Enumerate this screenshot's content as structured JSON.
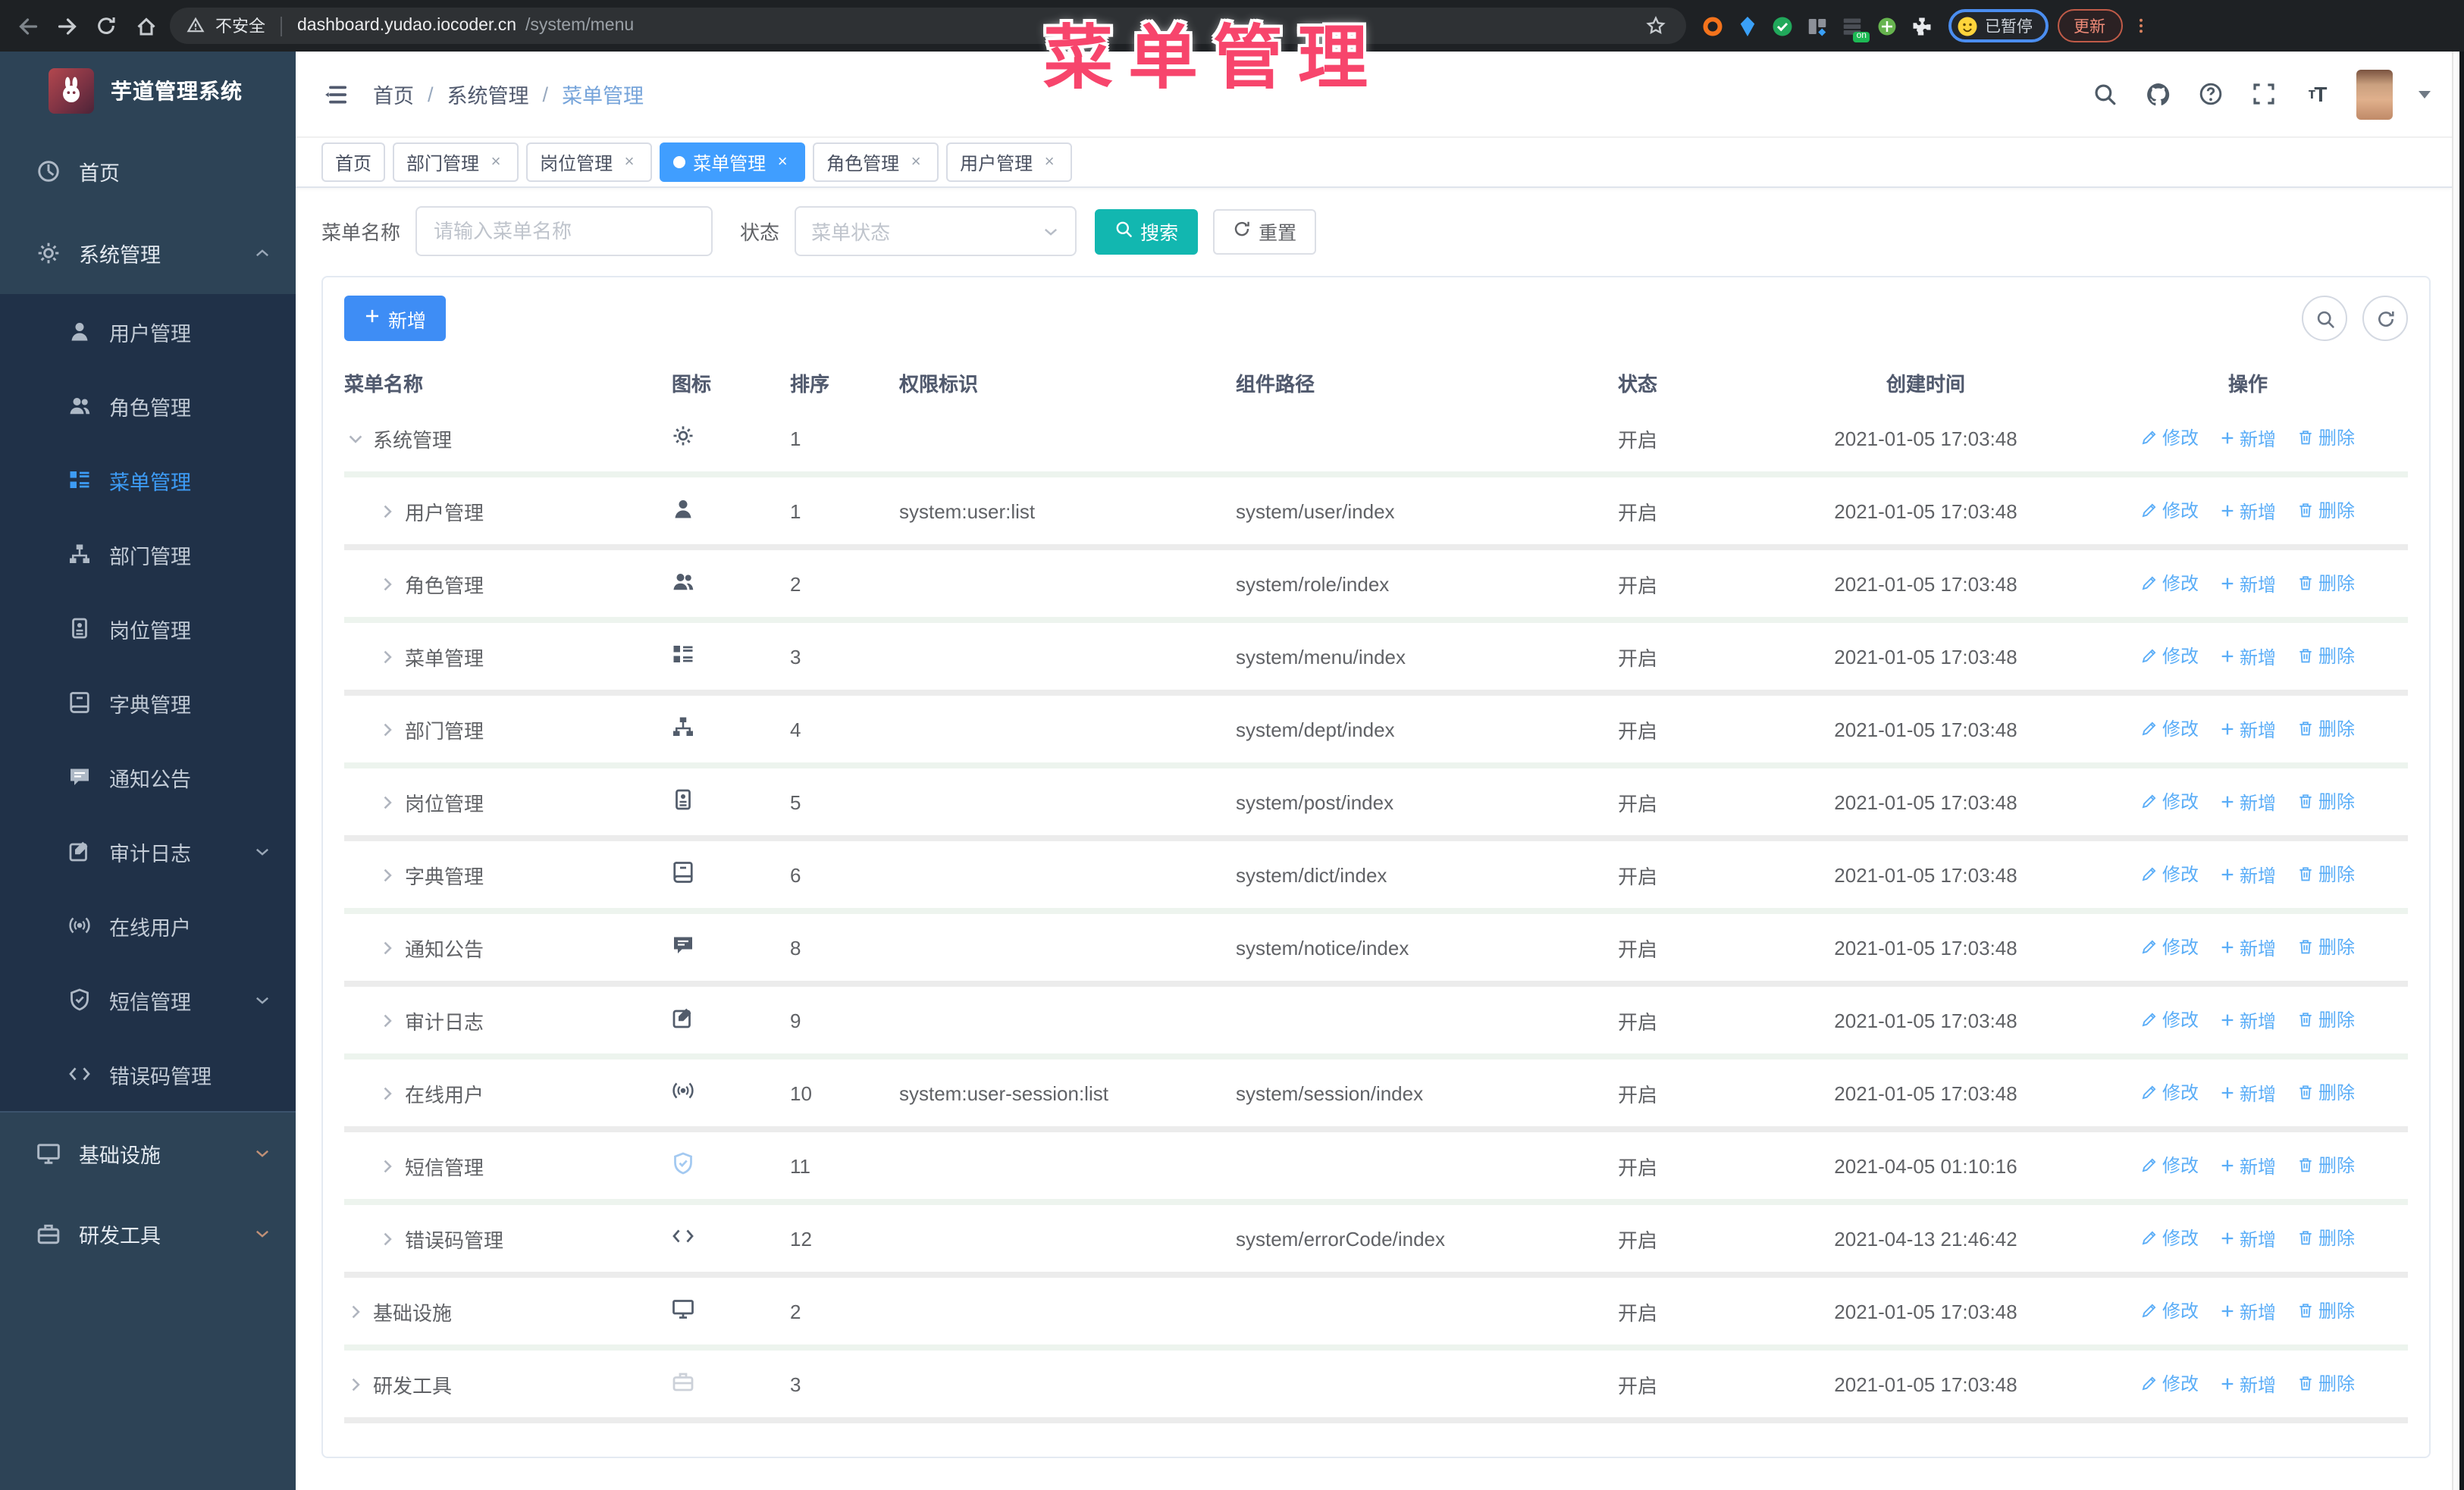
{
  "browser": {
    "security_label": "不安全",
    "url_host": "dashboard.yudao.iocoder.cn",
    "url_path": "/system/menu",
    "profile_label": "已暂停",
    "update_label": "更新",
    "extensions": [
      {
        "name": "ext-ring",
        "shape": "ring",
        "color": "#f4731c"
      },
      {
        "name": "ext-gem",
        "shape": "diamond",
        "color": "#3aa0f7"
      },
      {
        "name": "ext-check",
        "shape": "check-circle",
        "color": "#21a85b"
      },
      {
        "name": "ext-grid",
        "shape": "grid",
        "color": "#8d9199",
        "accent": "#3aa0f7"
      },
      {
        "name": "ext-stack",
        "shape": "stack",
        "color": "#4a4e55",
        "badge": "on"
      },
      {
        "name": "ext-leaf",
        "shape": "leaf",
        "color": "#66b44e"
      },
      {
        "name": "ext-puzzle",
        "shape": "puzzle",
        "color": "#e8eaed"
      }
    ]
  },
  "overlay": {
    "title": "菜单管理"
  },
  "sidebar": {
    "app_title": "芋道管理系统",
    "items": [
      {
        "label": "首页",
        "icon": "dashboard",
        "level": 1
      },
      {
        "label": "系统管理",
        "icon": "gear",
        "level": 1,
        "chevron": "up"
      },
      {
        "label": "用户管理",
        "icon": "user",
        "level": 2
      },
      {
        "label": "角色管理",
        "icon": "users",
        "level": 2
      },
      {
        "label": "菜单管理",
        "icon": "menu",
        "level": 2,
        "active": true
      },
      {
        "label": "部门管理",
        "icon": "tree",
        "level": 2
      },
      {
        "label": "岗位管理",
        "icon": "post",
        "level": 2
      },
      {
        "label": "字典管理",
        "icon": "dict",
        "level": 2
      },
      {
        "label": "通知公告",
        "icon": "message",
        "level": 2
      },
      {
        "label": "审计日志",
        "icon": "log",
        "level": 2,
        "chevron": "down"
      },
      {
        "label": "在线用户",
        "icon": "online",
        "level": 2
      },
      {
        "label": "短信管理",
        "icon": "sms",
        "level": 2,
        "chevron": "down"
      },
      {
        "label": "错误码管理",
        "icon": "code",
        "level": 2
      },
      {
        "label": "基础设施",
        "icon": "monitor",
        "level": 1,
        "chevron": "down",
        "section_top": true,
        "warm": true
      },
      {
        "label": "研发工具",
        "icon": "tool",
        "level": 1,
        "chevron": "down",
        "warm": true
      }
    ]
  },
  "header": {
    "breadcrumb": [
      "首页",
      "系统管理",
      "菜单管理"
    ],
    "separator": "/"
  },
  "tabs": [
    {
      "label": "首页",
      "closable": false,
      "active": false
    },
    {
      "label": "部门管理",
      "closable": true,
      "active": false
    },
    {
      "label": "岗位管理",
      "closable": true,
      "active": false
    },
    {
      "label": "菜单管理",
      "closable": true,
      "active": true
    },
    {
      "label": "角色管理",
      "closable": true,
      "active": false
    },
    {
      "label": "用户管理",
      "closable": true,
      "active": false
    }
  ],
  "filters": {
    "name_label": "菜单名称",
    "name_placeholder": "请输入菜单名称",
    "name_value": "",
    "status_label": "状态",
    "status_placeholder": "菜单状态",
    "search_label": "搜索",
    "reset_label": "重置"
  },
  "toolbar": {
    "add_label": "新增"
  },
  "table": {
    "columns": [
      "菜单名称",
      "图标",
      "排序",
      "权限标识",
      "组件路径",
      "状态",
      "创建时间",
      "操作"
    ],
    "ops": [
      "修改",
      "新增",
      "删除"
    ],
    "rows": [
      {
        "name": "系统管理",
        "icon": "gear",
        "level": 1,
        "expanded": true,
        "sort": "1",
        "perm": "",
        "path": "",
        "status": "开启",
        "time": "2021-01-05 17:03:48"
      },
      {
        "name": "用户管理",
        "icon": "user",
        "level": 2,
        "expanded": false,
        "sort": "1",
        "perm": "system:user:list",
        "path": "system/user/index",
        "status": "开启",
        "time": "2021-01-05 17:03:48"
      },
      {
        "name": "角色管理",
        "icon": "users",
        "level": 2,
        "expanded": false,
        "sort": "2",
        "perm": "",
        "path": "system/role/index",
        "status": "开启",
        "time": "2021-01-05 17:03:48"
      },
      {
        "name": "菜单管理",
        "icon": "menu",
        "level": 2,
        "expanded": false,
        "sort": "3",
        "perm": "",
        "path": "system/menu/index",
        "status": "开启",
        "time": "2021-01-05 17:03:48"
      },
      {
        "name": "部门管理",
        "icon": "tree",
        "level": 2,
        "expanded": false,
        "sort": "4",
        "perm": "",
        "path": "system/dept/index",
        "status": "开启",
        "time": "2021-01-05 17:03:48"
      },
      {
        "name": "岗位管理",
        "icon": "post",
        "level": 2,
        "expanded": false,
        "sort": "5",
        "perm": "",
        "path": "system/post/index",
        "status": "开启",
        "time": "2021-01-05 17:03:48"
      },
      {
        "name": "字典管理",
        "icon": "dict",
        "level": 2,
        "expanded": false,
        "sort": "6",
        "perm": "",
        "path": "system/dict/index",
        "status": "开启",
        "time": "2021-01-05 17:03:48"
      },
      {
        "name": "通知公告",
        "icon": "message",
        "level": 2,
        "expanded": false,
        "sort": "8",
        "perm": "",
        "path": "system/notice/index",
        "status": "开启",
        "time": "2021-01-05 17:03:48"
      },
      {
        "name": "审计日志",
        "icon": "log",
        "level": 2,
        "expanded": false,
        "sort": "9",
        "perm": "",
        "path": "",
        "status": "开启",
        "time": "2021-01-05 17:03:48"
      },
      {
        "name": "在线用户",
        "icon": "online",
        "level": 2,
        "expanded": false,
        "sort": "10",
        "perm": "system:user-session:list",
        "path": "system/session/index",
        "status": "开启",
        "time": "2021-01-05 17:03:48"
      },
      {
        "name": "短信管理",
        "icon": "sms",
        "icon_class": "light-blue",
        "level": 2,
        "expanded": false,
        "sort": "11",
        "perm": "",
        "path": "",
        "status": "开启",
        "time": "2021-04-05 01:10:16"
      },
      {
        "name": "错误码管理",
        "icon": "code",
        "level": 2,
        "expanded": false,
        "sort": "12",
        "perm": "",
        "path": "system/errorCode/index",
        "status": "开启",
        "time": "2021-04-13 21:46:42"
      },
      {
        "name": "基础设施",
        "icon": "monitor",
        "level": 1,
        "expanded": false,
        "sort": "2",
        "perm": "",
        "path": "",
        "status": "开启",
        "time": "2021-01-05 17:03:48"
      },
      {
        "name": "研发工具",
        "icon": "tool",
        "icon_class": "light-gray",
        "level": 1,
        "expanded": false,
        "sort": "3",
        "perm": "",
        "path": "",
        "status": "开启",
        "time": "2021-01-05 17:03:48"
      }
    ]
  }
}
